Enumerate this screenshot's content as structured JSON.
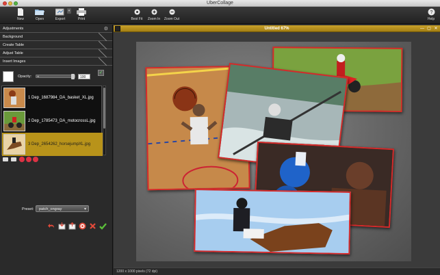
{
  "window": {
    "title": "UberCollage"
  },
  "toolbar": {
    "new_label": "New",
    "open_label": "Open",
    "export_label": "Export",
    "print_label": "Print",
    "best_fit_label": "Best Fit",
    "zoom_in_label": "Zoom In",
    "zoom_out_label": "Zoom Out",
    "help_label": "Help"
  },
  "sidebar": {
    "sections": [
      {
        "label": "Adjustments"
      },
      {
        "label": "Background"
      },
      {
        "label": "Create Table"
      },
      {
        "label": "Adjust Table"
      },
      {
        "label": "Insert Images"
      }
    ],
    "opacity_label": "Opacity:",
    "opacity_value": "100",
    "images": [
      {
        "label": "1 Dep_1687984_DA_basket_XL.jpg",
        "selected": false
      },
      {
        "label": "2 Dep_1785473_DA_motocrossL.jpg",
        "selected": false
      },
      {
        "label": "3 Dep_2654262_horsejumpXL.jpg",
        "selected": true
      }
    ],
    "preset_label": "Preset:",
    "preset_value": "patch_ongray"
  },
  "document": {
    "title": "Untitled 67%",
    "status": "1200 x 1000 pixels (72 dpi)"
  },
  "colors": {
    "accent_gold": "#b8931a",
    "photo_border": "#d62a2a"
  }
}
